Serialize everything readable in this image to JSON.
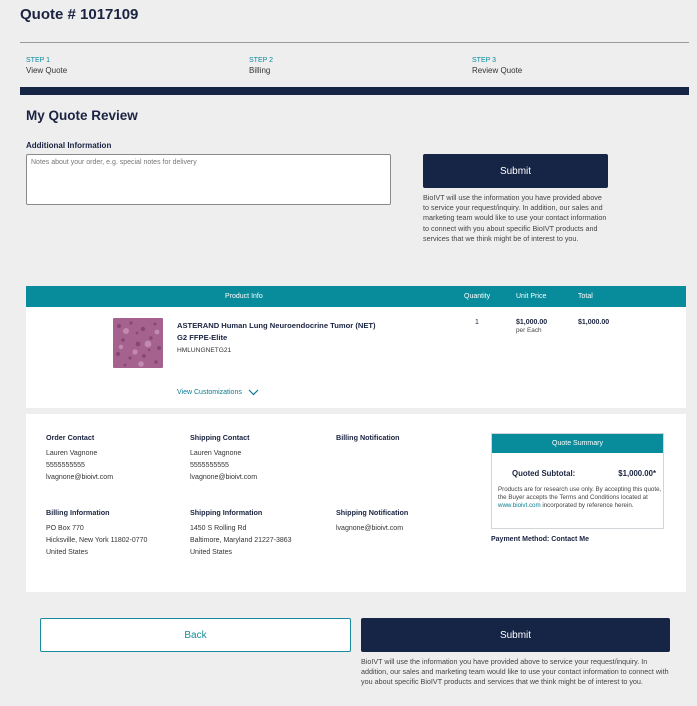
{
  "quote": {
    "title": "Quote # 1017109"
  },
  "steps": [
    {
      "num": "STEP 1",
      "name": "View Quote"
    },
    {
      "num": "STEP 2",
      "name": "Billing"
    },
    {
      "num": "STEP 3",
      "name": "Review Quote"
    }
  ],
  "review": {
    "heading": "My Quote Review",
    "additional_label": "Additional Information",
    "notes_placeholder": "Notes about your order, e.g. special notes for delivery",
    "notes_value": ""
  },
  "submit_label": "Submit",
  "disclaimer_text": "BioIVT will use the information you have provided above to service your request/inquiry. In addition, our sales and marketing team would like to use your contact information to connect with you about specific BioIVT products and services that we think might be of interest to you.",
  "table": {
    "headers": {
      "product": "Product Info",
      "quantity": "Quantity",
      "unit_price": "Unit Price",
      "total": "Total"
    },
    "item": {
      "name": "ASTERAND Human Lung Neuroendocrine Tumor (NET) G2 FFPE-Elite",
      "sku": "HMLUNGNETG21",
      "quantity": "1",
      "unit_price": "$1,000.00",
      "unit": "per Each",
      "total": "$1,000.00",
      "thumb_color": "#a5628f"
    },
    "view_customizations": "View Customizations"
  },
  "details": {
    "order_contact": {
      "heading": "Order Contact",
      "name": "Lauren Vagnone",
      "phone": "5555555555",
      "email": "lvagnone@bioivt.com"
    },
    "shipping_contact": {
      "heading": "Shipping Contact",
      "name": "Lauren Vagnone",
      "phone": "5555555555",
      "email": "lvagnone@bioivt.com"
    },
    "billing_notification": {
      "heading": "Billing Notification"
    },
    "billing_info": {
      "heading": "Billing Information",
      "line1": "PO Box 770",
      "line2": "Hicksville, New York 11802-0770",
      "line3": "United States"
    },
    "shipping_info": {
      "heading": "Shipping Information",
      "line1": "1450 S Rolling Rd",
      "line2": "Baltimore, Maryland 21227-3863",
      "line3": "United States"
    },
    "shipping_notification": {
      "heading": "Shipping Notification",
      "email": "lvagnone@bioivt.com"
    }
  },
  "summary": {
    "heading": "Quote Summary",
    "subtotal_label": "Quoted Subtotal:",
    "subtotal_value": "$1,000.00*",
    "note_pre": "Products are for research use only. By accepting this quote, the Buyer accepts the Terms and Conditions located at ",
    "note_link": "www.bioivt.com",
    "note_post": " incorporated by reference herein.",
    "payment_method": "Payment Method: Contact Me"
  },
  "back_label": "Back",
  "colors": {
    "navy": "#162445",
    "teal": "#088b9a",
    "background": "#eeeeee"
  }
}
